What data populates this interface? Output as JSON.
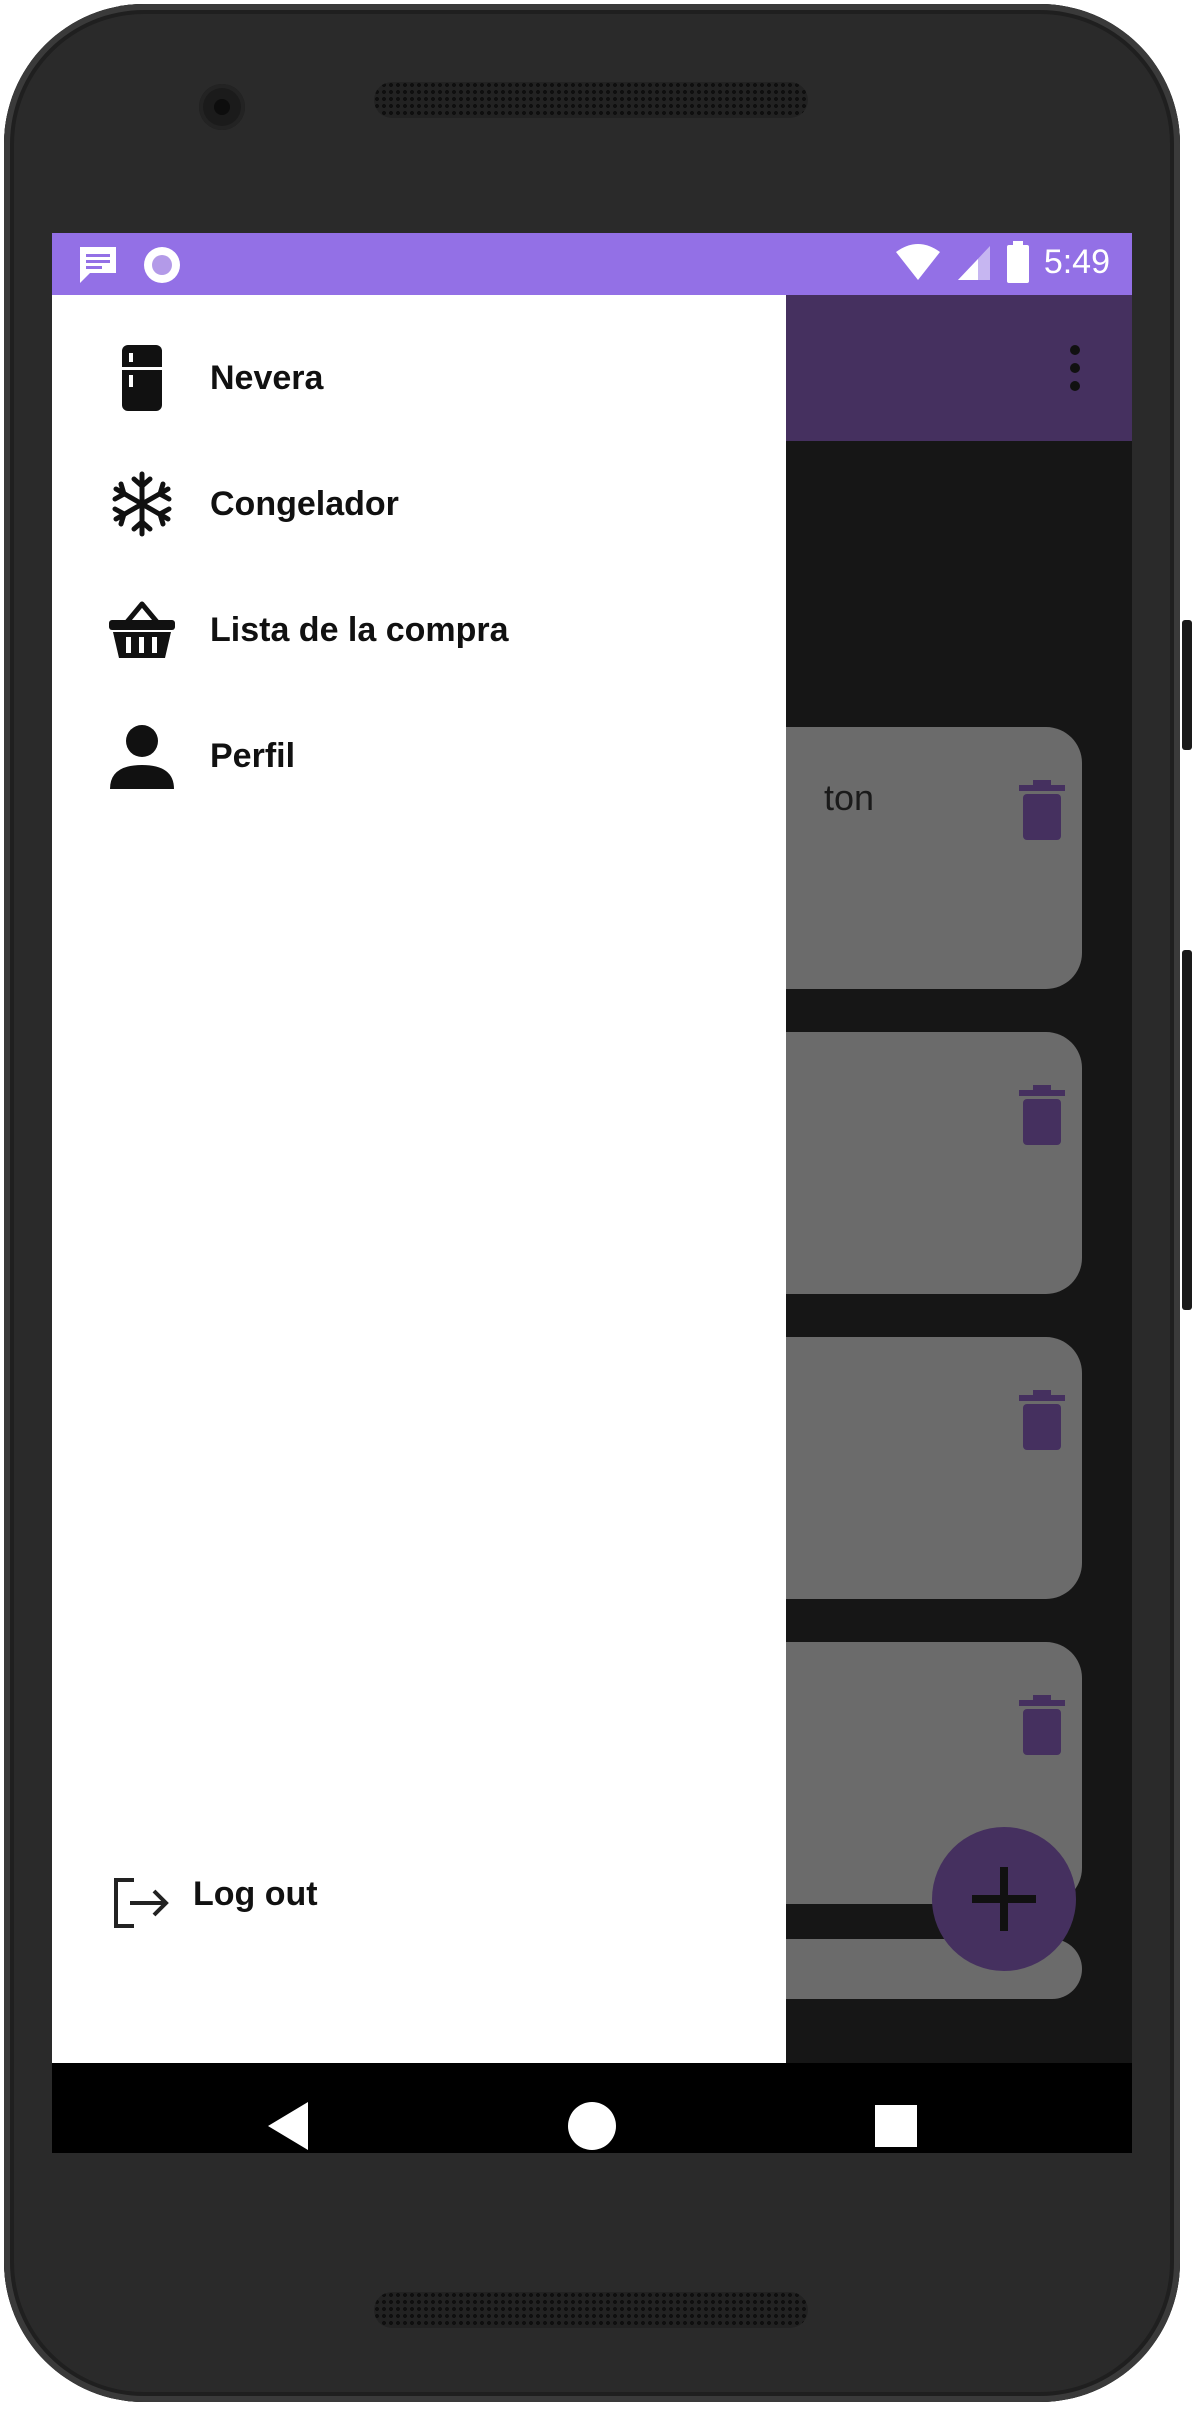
{
  "status_bar": {
    "time": "5:49",
    "left_icons": [
      "message-icon",
      "notification-dot-icon"
    ],
    "right_icons": [
      "wifi-icon",
      "signal-icon",
      "battery-icon"
    ],
    "color": "#9370e6"
  },
  "app_bar": {
    "color": "#45305f",
    "menu_icon": "more-vert-icon"
  },
  "drawer": {
    "items": [
      {
        "label": "Nevera",
        "icon": "fridge-icon"
      },
      {
        "label": "Congelador",
        "icon": "snowflake-icon"
      },
      {
        "label": "Lista de la compra",
        "icon": "basket-icon"
      },
      {
        "label": "Perfil",
        "icon": "person-icon"
      }
    ],
    "logout": {
      "label": "Log out",
      "icon": "logout-icon"
    }
  },
  "background_list": {
    "items": [
      {
        "text": "ton"
      },
      {
        "text": ""
      },
      {
        "text": ""
      },
      {
        "text": ""
      }
    ],
    "item_icon": "trash-icon"
  },
  "fab": {
    "icon": "plus-icon"
  },
  "nav_bar": {
    "buttons": [
      "back-icon",
      "home-icon",
      "recents-icon"
    ]
  },
  "colors": {
    "accent": "#9370e6",
    "primary_dark": "#45305f",
    "card": "#6b6b6b"
  }
}
